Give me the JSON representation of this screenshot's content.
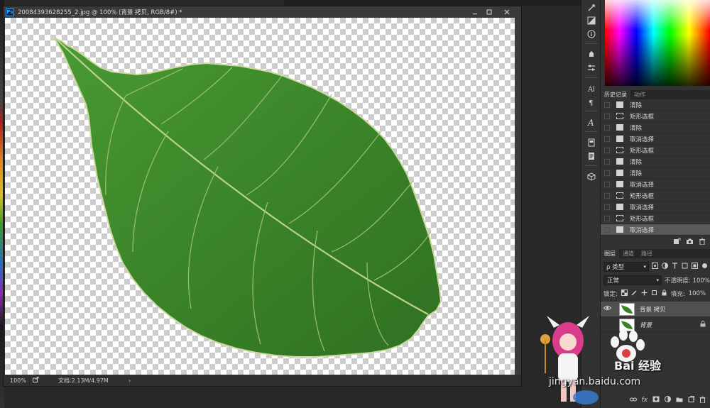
{
  "document": {
    "app_icon": "Ps",
    "title": "20084393628255_2.jpg @ 100% (背景 拷贝, RGB/8#) *",
    "controls": [
      "minimize-icon",
      "maximize-icon",
      "close-icon"
    ],
    "status": {
      "zoom": "100%",
      "doc_info": "文档:2.13M/4.97M",
      "arrow": "›"
    }
  },
  "history": {
    "tabs": [
      "历史记录",
      "动作"
    ],
    "active_tab": 0,
    "items": [
      {
        "label": "清除",
        "icon": "doc"
      },
      {
        "label": "矩形选框",
        "icon": "marquee"
      },
      {
        "label": "清除",
        "icon": "doc"
      },
      {
        "label": "取消选择",
        "icon": "doc"
      },
      {
        "label": "矩形选框",
        "icon": "marquee"
      },
      {
        "label": "清除",
        "icon": "doc"
      },
      {
        "label": "清除",
        "icon": "doc"
      },
      {
        "label": "取消选择",
        "icon": "doc"
      },
      {
        "label": "矩形选框",
        "icon": "marquee"
      },
      {
        "label": "取消选择",
        "icon": "doc"
      },
      {
        "label": "矩形选框",
        "icon": "marquee"
      },
      {
        "label": "取消选择",
        "icon": "doc"
      }
    ],
    "selected_index": 11
  },
  "layers": {
    "tabs": [
      "图层",
      "通道",
      "路径"
    ],
    "active_tab": 0,
    "filter": "ρ 类型",
    "blend_mode": "正常",
    "opacity_label": "不透明度:",
    "opacity_value": "100%",
    "lock_label": "锁定:",
    "fill_label": "填充:",
    "fill_value": "100%",
    "items": [
      {
        "name": "背景 拷贝",
        "visible": true,
        "locked": false
      },
      {
        "name": "背景",
        "visible": false,
        "locked": true
      }
    ],
    "selected_index": 0
  },
  "watermark": {
    "brand": "Bai 经验",
    "url": "jingyan.baidu.com"
  },
  "colors": {
    "leaf": "#3f8a2c",
    "leaf_dark": "#2c6a1e",
    "vein": "#b9d38c",
    "panel_bg": "#323232",
    "selected_row": "#595959"
  }
}
